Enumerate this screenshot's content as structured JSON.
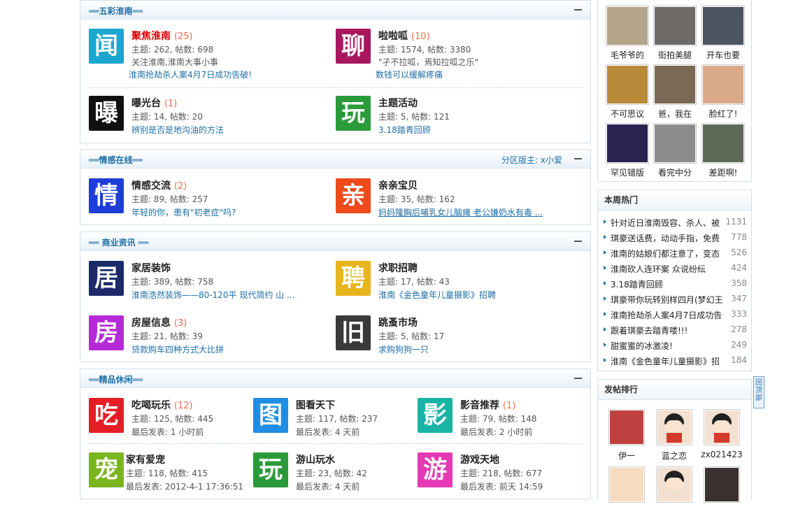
{
  "sections": [
    {
      "title": "══五彩淮南══",
      "moderator": ""
    },
    {
      "title": "══情感在线══",
      "moderator": "分区版主: x小爱"
    },
    {
      "title": "══ 商业资讯 ══",
      "moderator": ""
    },
    {
      "title": "══精品休闲══",
      "moderator": ""
    }
  ],
  "forums": {
    "wucai": [
      {
        "icon": "闻",
        "color": "#1aa6cf",
        "name": "聚焦淮南",
        "count": "(25)",
        "stat": "主题: 262, 帖数: 698",
        "desc": "关注淮南,淮南大事小事",
        "link": "淮南抢劫杀人案4月7日成功告破!"
      },
      {
        "icon": "聊",
        "color": "#a8175e",
        "name": "啦啦呱",
        "count": "(10)",
        "stat": "主题: 1574, 帖数: 3380",
        "desc": "\"孑不拉呱，焉知拉呱之乐\"",
        "link": "数钱可以缓解疼痛"
      },
      {
        "icon": "曝",
        "color": "#111111",
        "name": "曝光台",
        "count": "(1)",
        "stat": "主题: 14, 帖数: 20",
        "desc": "",
        "link": "辨别是否是地沟油的方法"
      },
      {
        "icon": "玩",
        "color": "#2a9a3a",
        "name": "主题活动",
        "count": "",
        "stat": "主题: 5, 帖数: 121",
        "desc": "",
        "link": "3.18踏青回顾"
      }
    ],
    "qinggan": [
      {
        "icon": "情",
        "color": "#1d3fd8",
        "name": "情感交流",
        "count": "(2)",
        "stat": "主题: 89, 帖数: 257",
        "desc": "",
        "link": "年轻的你，患有\"初老症\"吗?"
      },
      {
        "icon": "亲",
        "color": "#ee4a1c",
        "name": "亲亲宝贝",
        "count": "",
        "stat": "主题: 35, 帖数: 162",
        "desc": "",
        "link": "妈妈隆胸后哺乳女儿脑瘫 老公嫌奶水有毒 ..."
      }
    ],
    "shangye": [
      {
        "icon": "居",
        "color": "#1c2a6a",
        "name": "家居装饰",
        "count": "",
        "stat": "主题: 389, 帖数: 758",
        "desc": "",
        "link": "淮南浩然装饰——80-120平 现代简约 山 ..."
      },
      {
        "icon": "聘",
        "color": "#e7b61c",
        "name": "求职招聘",
        "count": "",
        "stat": "主题: 17, 帖数: 43",
        "desc": "",
        "link": "淮南《金色童年儿童摄影》招聘"
      },
      {
        "icon": "房",
        "color": "#b52ad6",
        "name": "房屋信息",
        "count": "(3)",
        "stat": "主题: 21, 帖数: 39",
        "desc": "",
        "link": "贷款购车四种方式大比拼"
      },
      {
        "icon": "旧",
        "color": "#3a3a3a",
        "name": "跳蚤市场",
        "count": "",
        "stat": "主题: 5, 帖数: 17",
        "desc": "",
        "link": "求购狗狗一只"
      }
    ],
    "jingpin": [
      {
        "icon": "吃",
        "color": "#e51d25",
        "name": "吃喝玩乐",
        "count": "(12)",
        "stat": "主题: 125, 帖数: 445",
        "desc": "最后发表: 1 小时前",
        "link": ""
      },
      {
        "icon": "图",
        "color": "#1f8ee2",
        "name": "图看天下",
        "count": "",
        "stat": "主题: 117, 帖数: 237",
        "desc": "最后发表: 4 天前",
        "link": ""
      },
      {
        "icon": "影",
        "color": "#1ab4a6",
        "name": "影音推荐",
        "count": "(1)",
        "stat": "主题: 79, 帖数: 148",
        "desc": "最后发表: 2 小时前",
        "link": ""
      },
      {
        "icon": "宠",
        "color": "#7ab51d",
        "name": "家有爱宠",
        "count": "",
        "stat": "主题: 118, 帖数: 415",
        "desc": "最后发表: 2012-4-1 17:36:51",
        "link": ""
      },
      {
        "icon": "玩",
        "color": "#2a9a3a",
        "name": "游山玩水",
        "count": "",
        "stat": "主题: 23, 帖数: 42",
        "desc": "最后发表: 4 天前",
        "link": ""
      },
      {
        "icon": "游",
        "color": "#e53ab5",
        "name": "游戏天地",
        "count": "",
        "stat": "主题: 218, 帖数: 677",
        "desc": "最后发表: 前天 14:59",
        "link": ""
      }
    ]
  },
  "pictures": [
    {
      "caption": "毛爷爷的",
      "color": "#b3a48a"
    },
    {
      "caption": "街拍美腿",
      "color": "#6d6a68"
    },
    {
      "caption": "开车也要",
      "color": "#4a5560"
    },
    {
      "caption": "不可思议",
      "color": "#b88a3a"
    },
    {
      "caption": "爸，我在",
      "color": "#7a6a55"
    },
    {
      "caption": "脸红了!",
      "color": "#d9a98a"
    },
    {
      "caption": "罕见错版",
      "color": "#2a2250"
    },
    {
      "caption": "看完中分",
      "color": "#8d8d8d"
    },
    {
      "caption": "差距啊!",
      "color": "#5d6a58"
    }
  ],
  "hot_week": {
    "title": "本周热门",
    "items": [
      {
        "title": "针对近日淮南毁容、杀人、被",
        "count": "1131"
      },
      {
        "title": "琪豪送话费，动动手指，免费",
        "count": "778"
      },
      {
        "title": "淮南的姑娘们都注意了，变态",
        "count": "526"
      },
      {
        "title": "淮南砍人连环案 众说纷纭",
        "count": "424"
      },
      {
        "title": "3.18踏青回顾",
        "count": "358"
      },
      {
        "title": "琪豪带你玩转别样四月(梦幻王",
        "count": "347"
      },
      {
        "title": "淮南抢劫杀人案4月7日成功告",
        "count": "333"
      },
      {
        "title": "跟着琪豪去踏青喽!!!",
        "count": "278"
      },
      {
        "title": "甜蜜蜜的冰激凌!",
        "count": "249"
      },
      {
        "title": "淮南《金色童年儿童摄影》招",
        "count": "184"
      }
    ]
  },
  "ranking": {
    "title": "发帖排行",
    "users": [
      {
        "name": "伊一",
        "color": "#c04040"
      },
      {
        "name": "蓝之恋",
        "color": "#d23a2a"
      },
      {
        "name": "zx021423",
        "color": "#d23a2a"
      },
      {
        "name": "",
        "color": "#e0a060"
      },
      {
        "name": "",
        "color": "#d23a2a"
      },
      {
        "name": "",
        "color": "#3a3030"
      }
    ]
  },
  "back_top": "回顶部"
}
